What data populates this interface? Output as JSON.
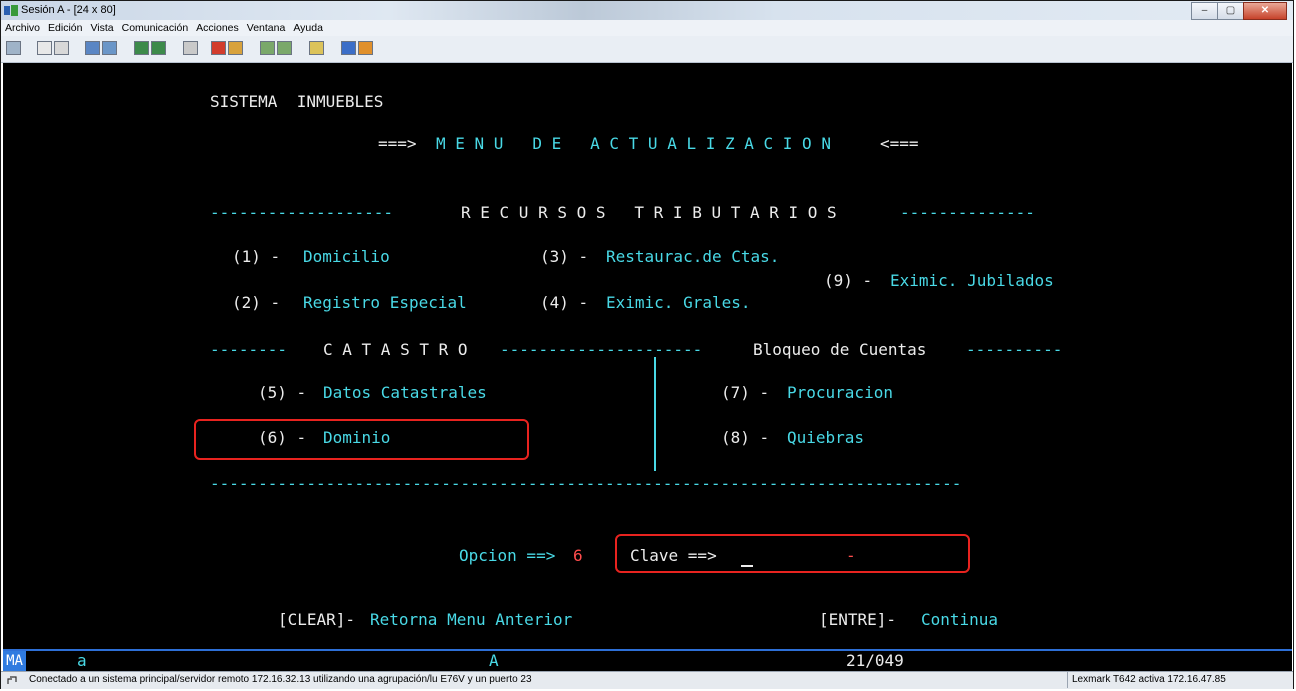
{
  "window": {
    "title": "Sesión A - [24 x 80]",
    "buttons": {
      "minimize": "–",
      "maximize": "▢",
      "close": "✕"
    }
  },
  "menu": [
    "Archivo",
    "Edición",
    "Vista",
    "Comunicación",
    "Acciones",
    "Ventana",
    "Ayuda"
  ],
  "toolbar_icons": [
    "display-icon",
    "copy-icon",
    "paste-icon",
    "send-icon",
    "receive-icon",
    "monitor-icon",
    "monitor-icon",
    "macro-icon",
    "record-icon",
    "play-icon",
    "download-icon",
    "upload-icon",
    "keyboard-icon",
    "palette-icon",
    "tag-icon"
  ],
  "screen": {
    "system_title": "SISTEMA  INMUEBLES",
    "menu_prefix": "===>",
    "menu_title": "M E N U   D E   A C T U A L I Z A C I O N",
    "menu_suffix": "<===",
    "recursos_left": "-------------------",
    "recursos_label": "R E C U R S O S   T R I B U T A R I O S",
    "recursos_right": "--------------",
    "options": {
      "o1": {
        "key": "(1) -",
        "label": "Domicilio"
      },
      "o2": {
        "key": "(2) -",
        "label": "Registro Especial"
      },
      "o3": {
        "key": "(3) -",
        "label": "Restaurac.de Ctas."
      },
      "o4": {
        "key": "(4) -",
        "label": "Eximic. Grales."
      },
      "o5": {
        "key": "(5) -",
        "label": "Datos Catastrales"
      },
      "o6": {
        "key": "(6) -",
        "label": "Dominio"
      },
      "o7": {
        "key": "(7) -",
        "label": "Procuracion"
      },
      "o8": {
        "key": "(8) -",
        "label": "Quiebras"
      },
      "o9": {
        "key": "(9) -",
        "label": "Eximic. Jubilados"
      }
    },
    "catastro_left": "--------",
    "catastro_label": "C A T A S T R O",
    "catastro_middle": "---------------------",
    "bloqueo_label": "Bloqueo de Cuentas",
    "bloqueo_right": "----------",
    "bottom_rule": "------------------------------------------------------------------------------",
    "opcion_label": "Opcion ==>",
    "opcion_value": "6",
    "clave_label": "Clave ==>",
    "clave_separator": "-",
    "clear_key": "[CLEAR]-",
    "clear_label": "Retorna Menu Anterior",
    "enter_key": "[ENTRE]-",
    "enter_label": "Continua"
  },
  "term_status": {
    "mode": "MA",
    "session": "a",
    "indicator": "A",
    "cursor_pos": "21/049"
  },
  "status": {
    "message": "Conectado a un sistema principal/servidor remoto 172.16.32.13 utilizando una agrupación/lu E76V y un puerto 23",
    "printer": "Lexmark T642 activa 172.16.47.85"
  },
  "colors": {
    "terminal_bg": "#000000",
    "field_cyan": "#49d9e6",
    "protected_white": "#ececec",
    "input_red": "#ff4d4d",
    "highlight": "#e8231f"
  }
}
